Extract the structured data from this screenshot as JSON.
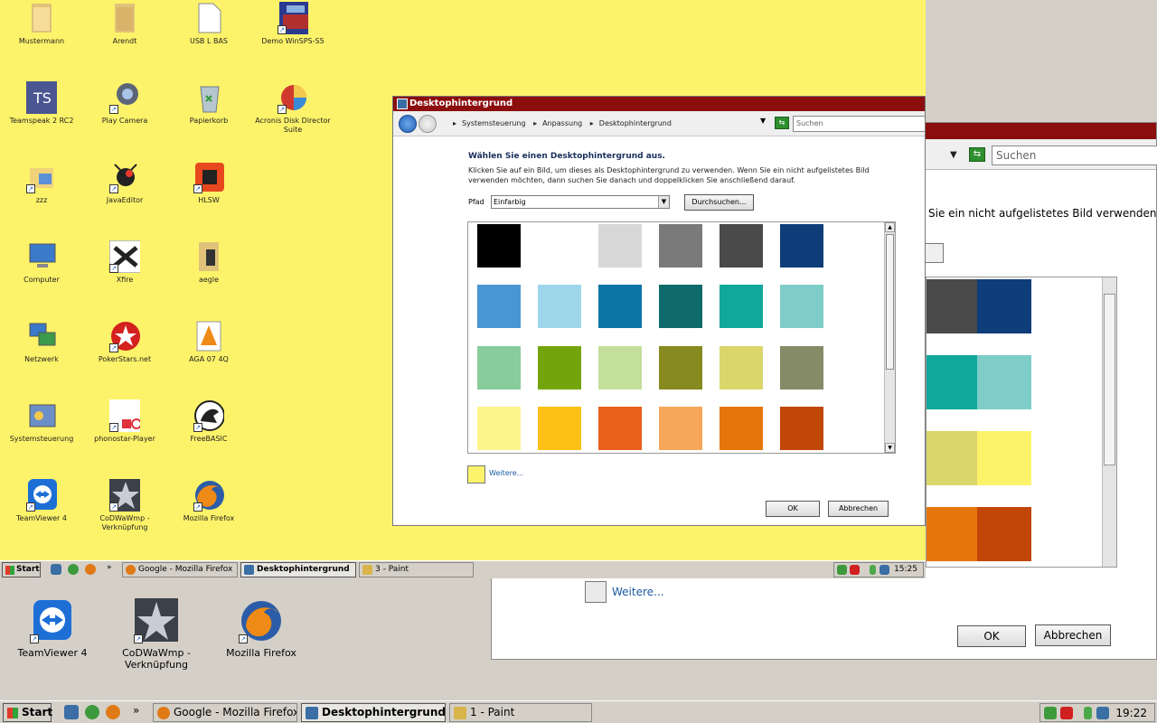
{
  "outer": {
    "desktop_icons": [
      {
        "label_1": "TeamViewer 4",
        "label_2": "",
        "icon": "teamviewer-icon"
      },
      {
        "label_1": "CoDWaWmp -",
        "label_2": "Verknüpfung",
        "icon": "codwawmp-icon"
      },
      {
        "label_1": "Mozilla Firefox",
        "label_2": "",
        "icon": "firefox-icon"
      }
    ],
    "bg_window": {
      "search_placeholder": "Suchen",
      "partial_text": "Sie ein nicht aufgelistetes Bild verwenden",
      "more_link": "Weitere...",
      "ok_label": "OK",
      "cancel_label": "Abbrechen",
      "swatches": [
        "#4a4a4a",
        "#0f3d7a",
        "#10a89a",
        "#7ecdc8",
        "#dad66c",
        "#fdf36a",
        "#e6760c",
        "#c14709"
      ]
    },
    "taskbar": {
      "start_label": "Start",
      "quicklaunch_more": "»",
      "tasks": [
        "Google - Mozilla Firefox",
        "Desktophintergrund",
        "1 - Paint"
      ],
      "clock": "19:22"
    }
  },
  "inner": {
    "desktop_icons": [
      {
        "label_1": "Mustermann",
        "label_2": "",
        "icon": "folder-icon"
      },
      {
        "label_1": "Arendt",
        "label_2": "",
        "icon": "folder-icon"
      },
      {
        "label_1": "USB L BAS",
        "label_2": "",
        "icon": "file-icon"
      },
      {
        "label_1": "Demo WinSPS-S5",
        "label_2": "",
        "icon": "winsps-icon"
      },
      {
        "label_1": "Teamspeak 2 RC2",
        "label_2": "",
        "icon": "teamspeak-icon"
      },
      {
        "label_1": "Play Camera",
        "label_2": "",
        "icon": "camera-icon"
      },
      {
        "label_1": "Papierkorb",
        "label_2": "",
        "icon": "recycle-bin-icon"
      },
      {
        "label_1": "Acronis Disk Director",
        "label_2": "Suite",
        "icon": "acronis-icon"
      },
      {
        "label_1": "zzz",
        "label_2": "",
        "icon": "folder-icon"
      },
      {
        "label_1": "JavaEditor",
        "label_2": "",
        "icon": "javaeditor-icon"
      },
      {
        "label_1": "HLSW",
        "label_2": "",
        "icon": "hlsw-icon"
      },
      {
        "label_1": "Computer",
        "label_2": "",
        "icon": "computer-icon"
      },
      {
        "label_1": "Xfire",
        "label_2": "",
        "icon": "xfire-icon"
      },
      {
        "label_1": "aegle",
        "label_2": "",
        "icon": "folder-icon"
      },
      {
        "label_1": "Netzwerk",
        "label_2": "",
        "icon": "network-icon"
      },
      {
        "label_1": "PokerStars.net",
        "label_2": "",
        "icon": "pokerstars-icon"
      },
      {
        "label_1": "AGA 07 4Q",
        "label_2": "",
        "icon": "vlc-icon"
      },
      {
        "label_1": "Systemsteuerung",
        "label_2": "",
        "icon": "control-panel-icon"
      },
      {
        "label_1": "phonostar-Player",
        "label_2": "",
        "icon": "phonostar-icon"
      },
      {
        "label_1": "FreeBASIC",
        "label_2": "",
        "icon": "freebasic-icon"
      },
      {
        "label_1": "TeamViewer 4",
        "label_2": "",
        "icon": "teamviewer-icon"
      },
      {
        "label_1": "CoDWaWmp -",
        "label_2": "Verknüpfung",
        "icon": "codwawmp-icon"
      },
      {
        "label_1": "Mozilla Firefox",
        "label_2": "",
        "icon": "firefox-icon"
      }
    ],
    "dialog": {
      "title": "Desktophintergrund",
      "breadcrumbs": [
        "Systemsteuerung",
        "Anpassung",
        "Desktophintergrund"
      ],
      "search_placeholder": "Suchen",
      "heading": "Wählen Sie einen Desktophintergrund aus.",
      "description": "Klicken Sie auf ein Bild, um dieses als Desktophintergrund zu verwenden. Wenn Sie ein nicht aufgelistetes Bild verwenden möchten, dann suchen Sie danach und doppelklicken Sie anschließend darauf.",
      "path_label": "Pfad",
      "path_value": "Einfarbig",
      "browse_label": "Durchsuchen...",
      "swatches": [
        "#000000",
        "#ffffff",
        "#d8d8d8",
        "#7a7a7a",
        "#4a4a4a",
        "#0f3d7a",
        "#4a96d2",
        "#9dd6ea",
        "#0b74a4",
        "#0f6b6b",
        "#10a89a",
        "#7ecdc8",
        "#88cc9c",
        "#74a40c",
        "#c4de9c",
        "#878a1e",
        "#dad66c",
        "#848b66",
        "#fdf58c",
        "#fdc116",
        "#e8601c",
        "#f7a75a",
        "#e6760c",
        "#c14709"
      ],
      "selected_color": "#fdf36a",
      "more_link": "Weitere...",
      "ok_label": "OK",
      "cancel_label": "Abbrechen"
    },
    "taskbar": {
      "start_label": "Start",
      "quicklaunch_more": "»",
      "tasks": [
        "Google - Mozilla Firefox",
        "Desktophintergrund",
        "3 - Paint"
      ],
      "clock": "15:25"
    }
  }
}
